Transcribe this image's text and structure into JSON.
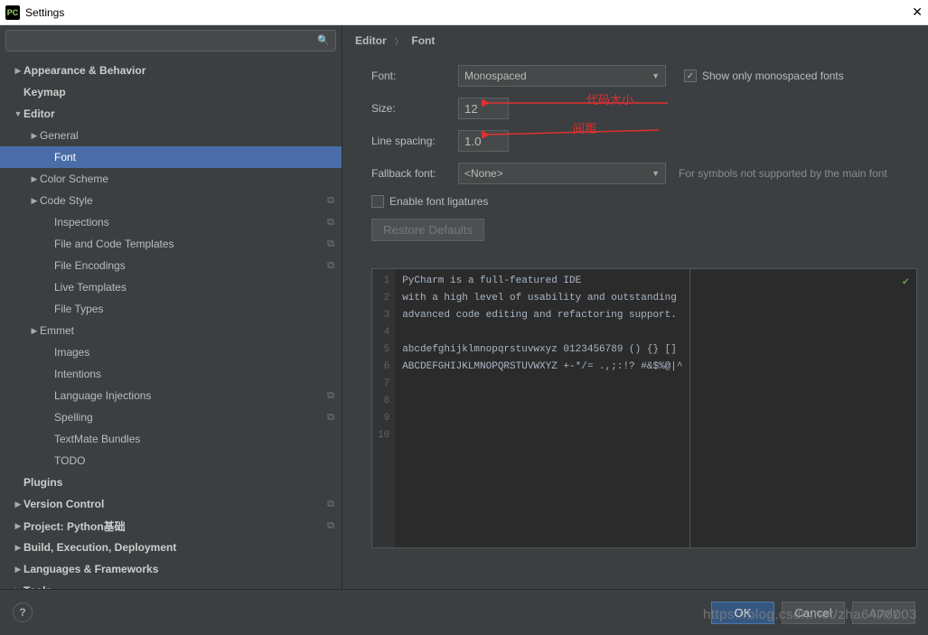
{
  "window": {
    "title": "Settings",
    "app_icon": "PC"
  },
  "search": {
    "placeholder": ""
  },
  "tree": [
    {
      "lvl": 0,
      "arrow": "▶",
      "label": "Appearance & Behavior",
      "bold": true
    },
    {
      "lvl": 0,
      "arrow": "",
      "label": "Keymap",
      "bold": true
    },
    {
      "lvl": 0,
      "arrow": "▼",
      "label": "Editor",
      "bold": true
    },
    {
      "lvl": 1,
      "arrow": "▶",
      "label": "General"
    },
    {
      "lvl": 2,
      "arrow": "",
      "label": "Font",
      "selected": true
    },
    {
      "lvl": 1,
      "arrow": "▶",
      "label": "Color Scheme"
    },
    {
      "lvl": 1,
      "arrow": "▶",
      "label": "Code Style",
      "copy": true
    },
    {
      "lvl": 2,
      "arrow": "",
      "label": "Inspections",
      "copy": true
    },
    {
      "lvl": 2,
      "arrow": "",
      "label": "File and Code Templates",
      "copy": true
    },
    {
      "lvl": 2,
      "arrow": "",
      "label": "File Encodings",
      "copy": true
    },
    {
      "lvl": 2,
      "arrow": "",
      "label": "Live Templates"
    },
    {
      "lvl": 2,
      "arrow": "",
      "label": "File Types"
    },
    {
      "lvl": 1,
      "arrow": "▶",
      "label": "Emmet"
    },
    {
      "lvl": 2,
      "arrow": "",
      "label": "Images"
    },
    {
      "lvl": 2,
      "arrow": "",
      "label": "Intentions"
    },
    {
      "lvl": 2,
      "arrow": "",
      "label": "Language Injections",
      "copy": true
    },
    {
      "lvl": 2,
      "arrow": "",
      "label": "Spelling",
      "copy": true
    },
    {
      "lvl": 2,
      "arrow": "",
      "label": "TextMate Bundles"
    },
    {
      "lvl": 2,
      "arrow": "",
      "label": "TODO"
    },
    {
      "lvl": 0,
      "arrow": "",
      "label": "Plugins",
      "bold": true
    },
    {
      "lvl": 0,
      "arrow": "▶",
      "label": "Version Control",
      "bold": true,
      "copy": true
    },
    {
      "lvl": 0,
      "arrow": "▶",
      "label": "Project: Python基础",
      "bold": true,
      "copy": true
    },
    {
      "lvl": 0,
      "arrow": "▶",
      "label": "Build, Execution, Deployment",
      "bold": true
    },
    {
      "lvl": 0,
      "arrow": "▶",
      "label": "Languages & Frameworks",
      "bold": true
    },
    {
      "lvl": 0,
      "arrow": "▶",
      "label": "Tools",
      "bold": true
    }
  ],
  "breadcrumb": {
    "a": "Editor",
    "b": "Font"
  },
  "form": {
    "font_label": "Font:",
    "font_value": "Monospaced",
    "mono_label": "Show only monospaced fonts",
    "size_label": "Size:",
    "size_value": "12",
    "spacing_label": "Line spacing:",
    "spacing_value": "1.0",
    "fallback_label": "Fallback font:",
    "fallback_value": "<None>",
    "fallback_hint": "For symbols not supported by the main font",
    "ligatures_label": "Enable font ligatures",
    "restore": "Restore Defaults"
  },
  "annotations": {
    "size": "代码大小",
    "spacing": "间距"
  },
  "preview_lines": [
    "PyCharm is a full-featured IDE",
    "with a high level of usability and outstanding",
    "advanced code editing and refactoring support.",
    "",
    "abcdefghijklmnopqrstuvwxyz 0123456789 () {} []",
    "ABCDEFGHIJKLMNOPQRSTUVWXYZ +-*/= .,;:!? #&$%@|^",
    "",
    "",
    "",
    ""
  ],
  "footer": {
    "ok": "OK",
    "cancel": "Cancel",
    "apply": "Apply"
  },
  "watermark": "https://blog.csdn.net/zha6476003"
}
